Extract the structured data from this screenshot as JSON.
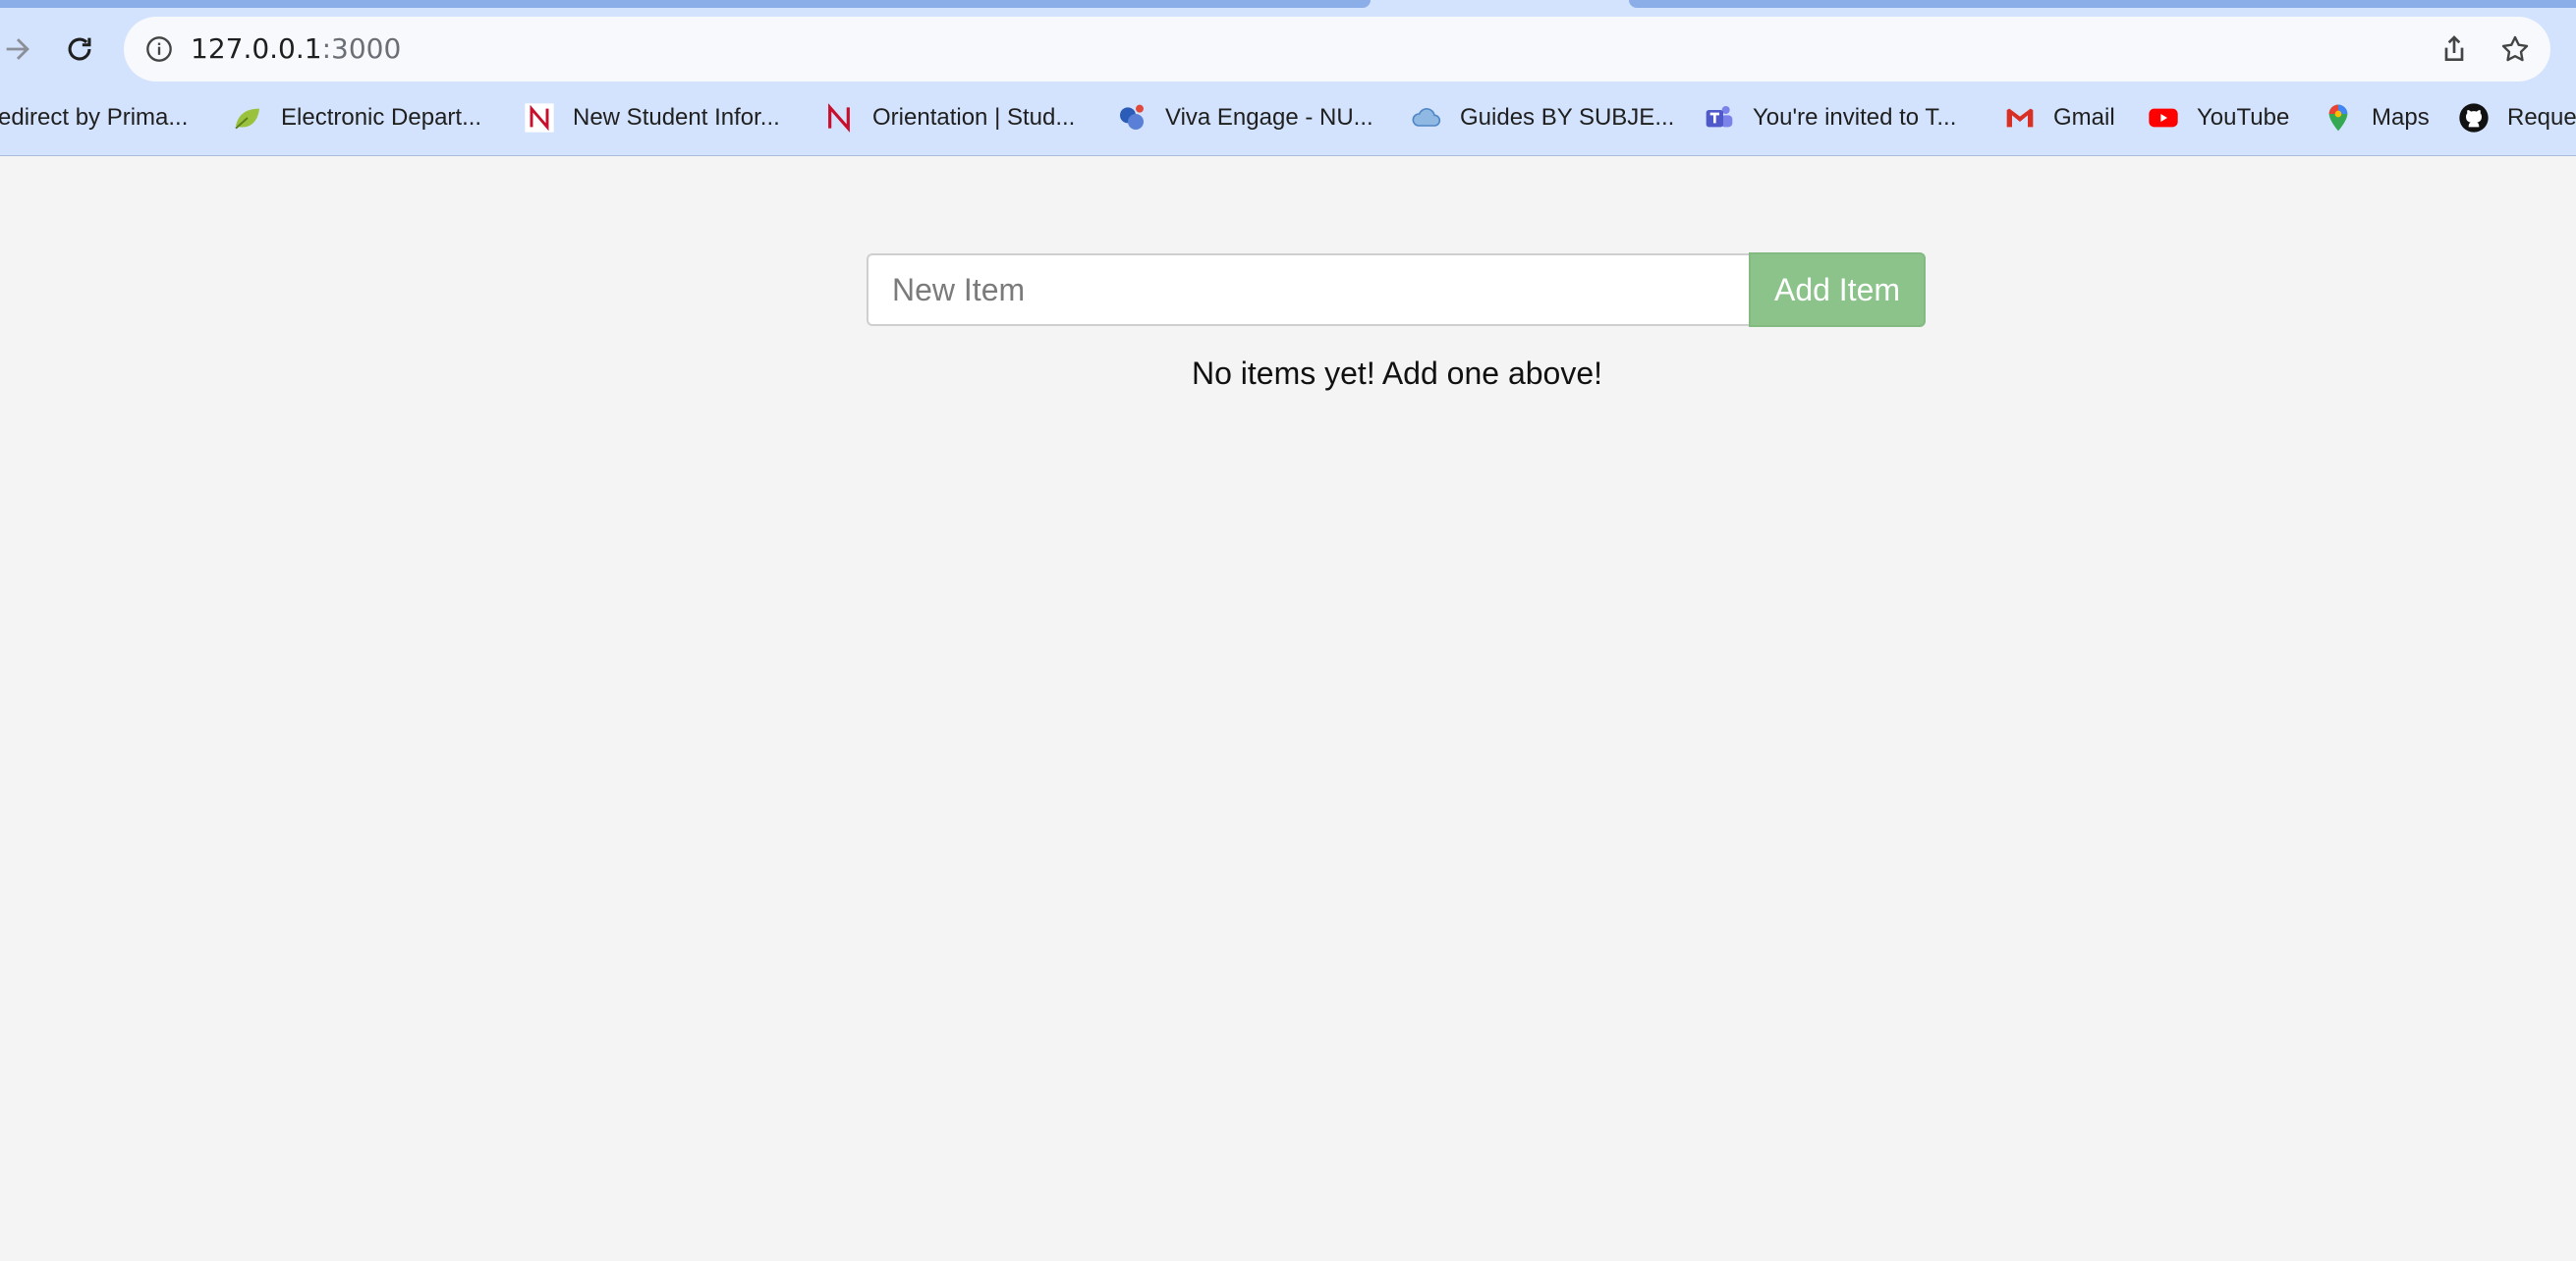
{
  "browser": {
    "url_host": "127.0.0.1",
    "url_port": ":3000",
    "bookmarks": [
      {
        "label": "edirect by Prima...",
        "icon": "none"
      },
      {
        "label": "Electronic Depart...",
        "icon": "leaf-icon"
      },
      {
        "label": "New Student Infor...",
        "icon": "northeastern-n-icon"
      },
      {
        "label": "Orientation | Stud...",
        "icon": "northeastern-n-icon"
      },
      {
        "label": "Viva Engage - NU...",
        "icon": "viva-engage-icon"
      },
      {
        "label": "Guides BY SUBJE...",
        "icon": "cloud-icon"
      },
      {
        "label": "You're invited to T...",
        "icon": "teams-icon"
      },
      {
        "label": "Gmail",
        "icon": "gmail-icon"
      },
      {
        "label": "YouTube",
        "icon": "youtube-icon"
      },
      {
        "label": "Maps",
        "icon": "maps-pin-icon"
      },
      {
        "label": "Reque",
        "icon": "github-icon"
      }
    ]
  },
  "app": {
    "input_placeholder": "New Item",
    "add_button_label": "Add Item",
    "empty_message": "No items yet! Add one above!"
  },
  "colors": {
    "page_background": "#f4f4f4",
    "chrome_background": "#d3e3fd",
    "add_button": "#8bc38b"
  }
}
